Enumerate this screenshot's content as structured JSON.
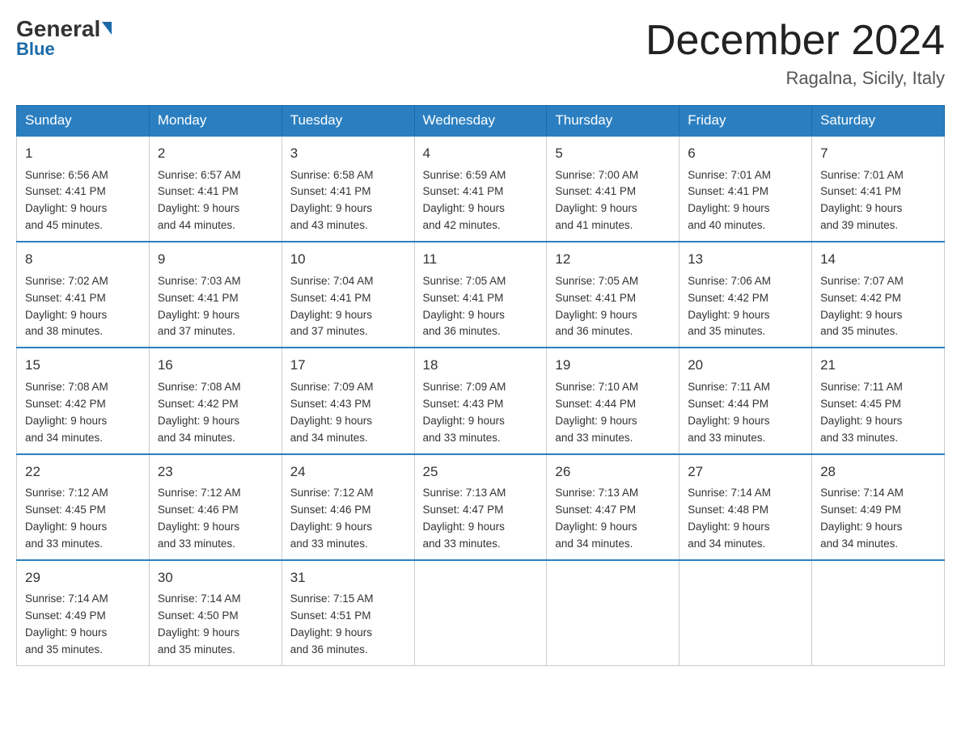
{
  "header": {
    "logo_general": "General",
    "logo_blue": "Blue",
    "month_title": "December 2024",
    "location": "Ragalna, Sicily, Italy"
  },
  "days_of_week": [
    "Sunday",
    "Monday",
    "Tuesday",
    "Wednesday",
    "Thursday",
    "Friday",
    "Saturday"
  ],
  "weeks": [
    [
      {
        "day": "1",
        "sunrise": "6:56 AM",
        "sunset": "4:41 PM",
        "daylight": "9 hours and 45 minutes."
      },
      {
        "day": "2",
        "sunrise": "6:57 AM",
        "sunset": "4:41 PM",
        "daylight": "9 hours and 44 minutes."
      },
      {
        "day": "3",
        "sunrise": "6:58 AM",
        "sunset": "4:41 PM",
        "daylight": "9 hours and 43 minutes."
      },
      {
        "day": "4",
        "sunrise": "6:59 AM",
        "sunset": "4:41 PM",
        "daylight": "9 hours and 42 minutes."
      },
      {
        "day": "5",
        "sunrise": "7:00 AM",
        "sunset": "4:41 PM",
        "daylight": "9 hours and 41 minutes."
      },
      {
        "day": "6",
        "sunrise": "7:01 AM",
        "sunset": "4:41 PM",
        "daylight": "9 hours and 40 minutes."
      },
      {
        "day": "7",
        "sunrise": "7:01 AM",
        "sunset": "4:41 PM",
        "daylight": "9 hours and 39 minutes."
      }
    ],
    [
      {
        "day": "8",
        "sunrise": "7:02 AM",
        "sunset": "4:41 PM",
        "daylight": "9 hours and 38 minutes."
      },
      {
        "day": "9",
        "sunrise": "7:03 AM",
        "sunset": "4:41 PM",
        "daylight": "9 hours and 37 minutes."
      },
      {
        "day": "10",
        "sunrise": "7:04 AM",
        "sunset": "4:41 PM",
        "daylight": "9 hours and 37 minutes."
      },
      {
        "day": "11",
        "sunrise": "7:05 AM",
        "sunset": "4:41 PM",
        "daylight": "9 hours and 36 minutes."
      },
      {
        "day": "12",
        "sunrise": "7:05 AM",
        "sunset": "4:41 PM",
        "daylight": "9 hours and 36 minutes."
      },
      {
        "day": "13",
        "sunrise": "7:06 AM",
        "sunset": "4:42 PM",
        "daylight": "9 hours and 35 minutes."
      },
      {
        "day": "14",
        "sunrise": "7:07 AM",
        "sunset": "4:42 PM",
        "daylight": "9 hours and 35 minutes."
      }
    ],
    [
      {
        "day": "15",
        "sunrise": "7:08 AM",
        "sunset": "4:42 PM",
        "daylight": "9 hours and 34 minutes."
      },
      {
        "day": "16",
        "sunrise": "7:08 AM",
        "sunset": "4:42 PM",
        "daylight": "9 hours and 34 minutes."
      },
      {
        "day": "17",
        "sunrise": "7:09 AM",
        "sunset": "4:43 PM",
        "daylight": "9 hours and 34 minutes."
      },
      {
        "day": "18",
        "sunrise": "7:09 AM",
        "sunset": "4:43 PM",
        "daylight": "9 hours and 33 minutes."
      },
      {
        "day": "19",
        "sunrise": "7:10 AM",
        "sunset": "4:44 PM",
        "daylight": "9 hours and 33 minutes."
      },
      {
        "day": "20",
        "sunrise": "7:11 AM",
        "sunset": "4:44 PM",
        "daylight": "9 hours and 33 minutes."
      },
      {
        "day": "21",
        "sunrise": "7:11 AM",
        "sunset": "4:45 PM",
        "daylight": "9 hours and 33 minutes."
      }
    ],
    [
      {
        "day": "22",
        "sunrise": "7:12 AM",
        "sunset": "4:45 PM",
        "daylight": "9 hours and 33 minutes."
      },
      {
        "day": "23",
        "sunrise": "7:12 AM",
        "sunset": "4:46 PM",
        "daylight": "9 hours and 33 minutes."
      },
      {
        "day": "24",
        "sunrise": "7:12 AM",
        "sunset": "4:46 PM",
        "daylight": "9 hours and 33 minutes."
      },
      {
        "day": "25",
        "sunrise": "7:13 AM",
        "sunset": "4:47 PM",
        "daylight": "9 hours and 33 minutes."
      },
      {
        "day": "26",
        "sunrise": "7:13 AM",
        "sunset": "4:47 PM",
        "daylight": "9 hours and 34 minutes."
      },
      {
        "day": "27",
        "sunrise": "7:14 AM",
        "sunset": "4:48 PM",
        "daylight": "9 hours and 34 minutes."
      },
      {
        "day": "28",
        "sunrise": "7:14 AM",
        "sunset": "4:49 PM",
        "daylight": "9 hours and 34 minutes."
      }
    ],
    [
      {
        "day": "29",
        "sunrise": "7:14 AM",
        "sunset": "4:49 PM",
        "daylight": "9 hours and 35 minutes."
      },
      {
        "day": "30",
        "sunrise": "7:14 AM",
        "sunset": "4:50 PM",
        "daylight": "9 hours and 35 minutes."
      },
      {
        "day": "31",
        "sunrise": "7:15 AM",
        "sunset": "4:51 PM",
        "daylight": "9 hours and 36 minutes."
      },
      null,
      null,
      null,
      null
    ]
  ]
}
